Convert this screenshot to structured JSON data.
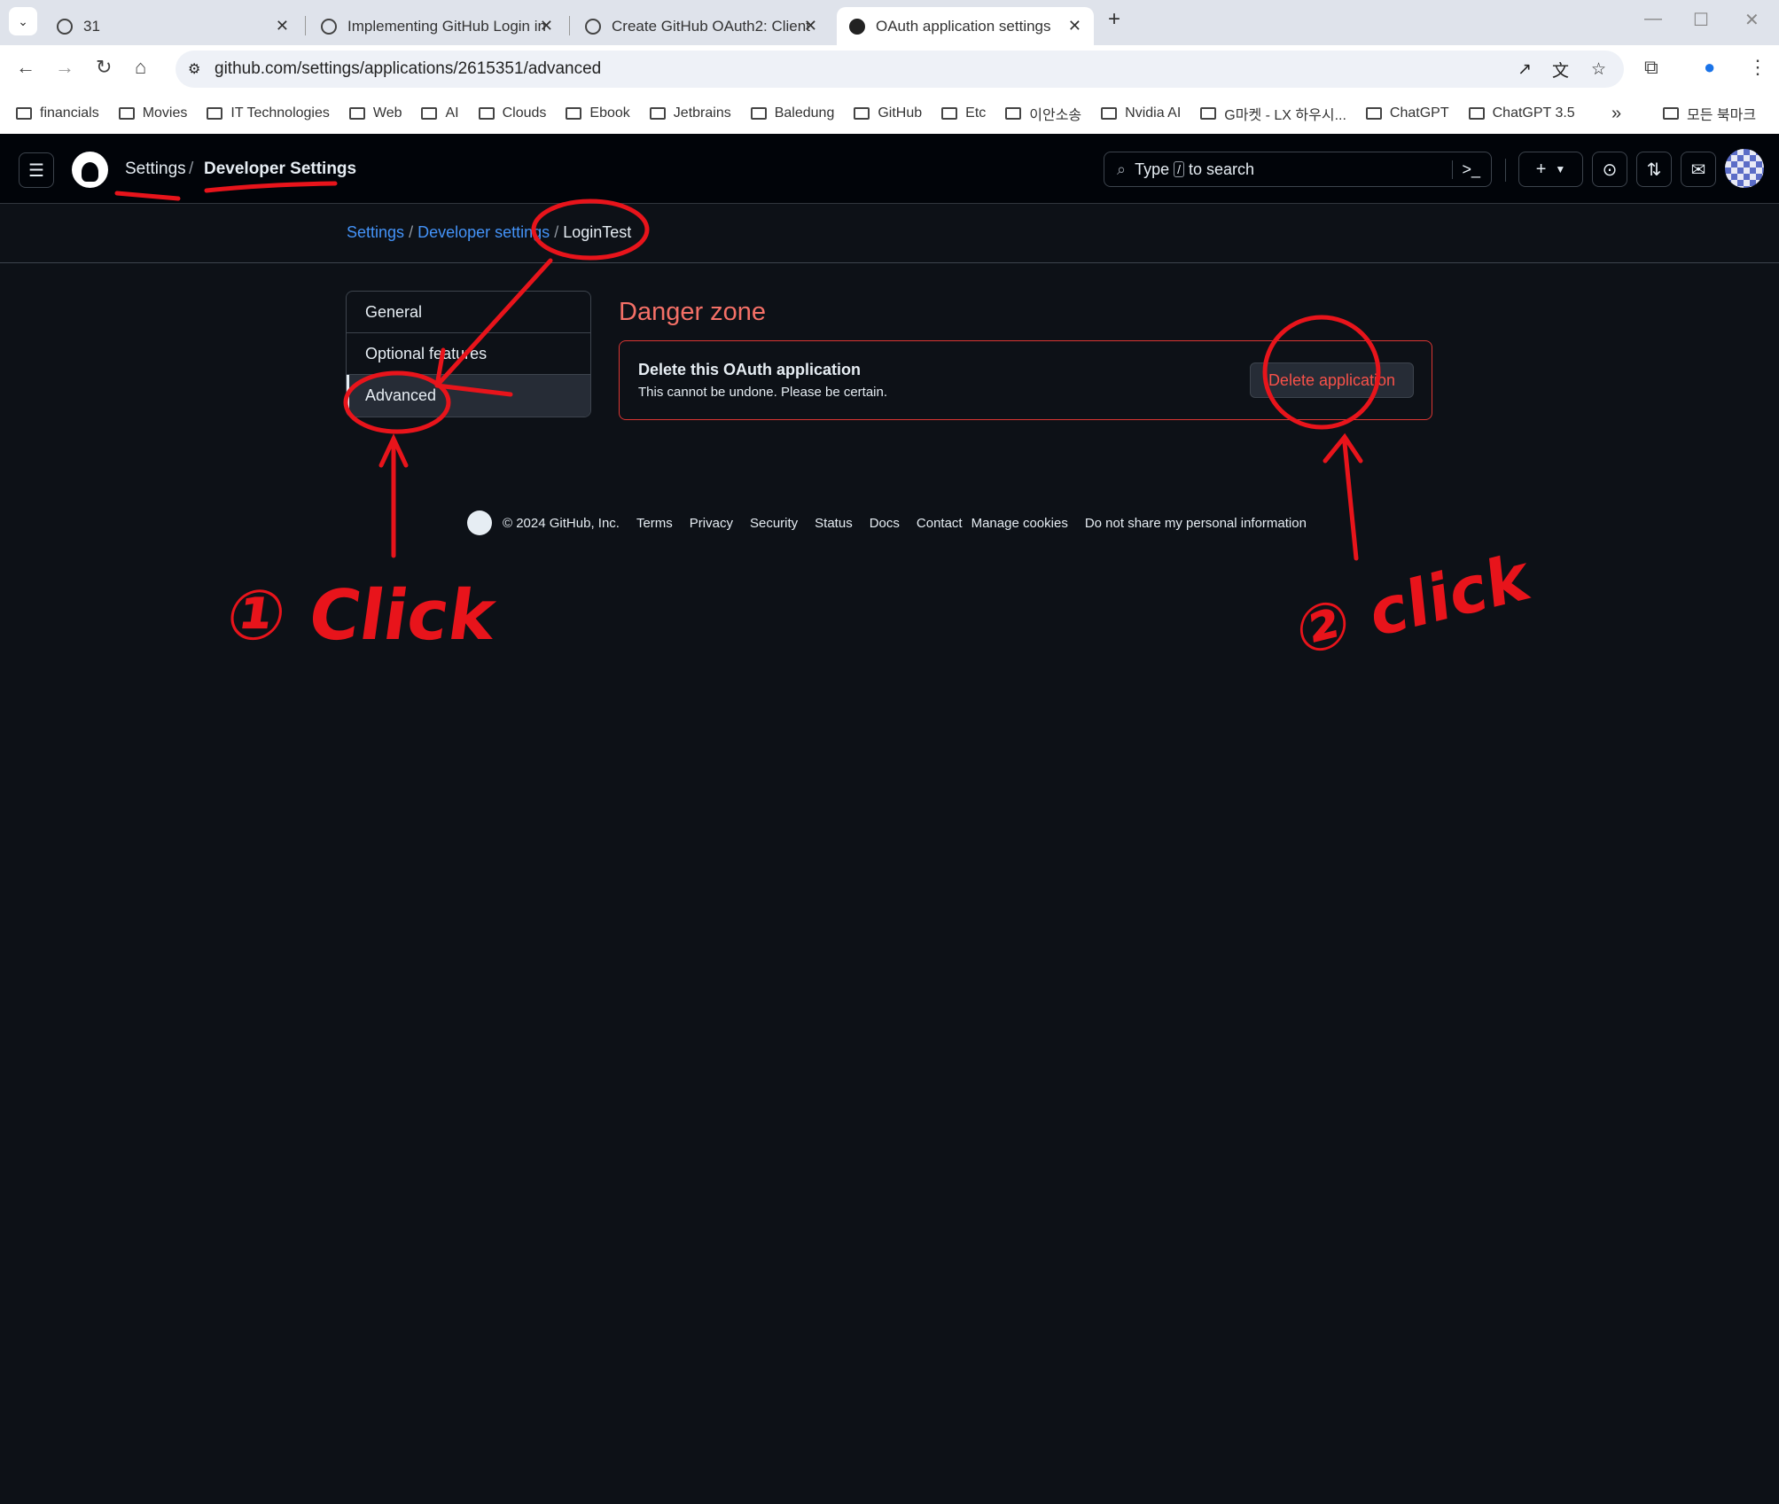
{
  "browser": {
    "tabs": [
      {
        "title": "31",
        "icon": "chatgpt-icon"
      },
      {
        "title": "Implementing GitHub Login in",
        "icon": "chatgpt-icon"
      },
      {
        "title": "Create GitHub OAuth2: Client",
        "icon": "chatgpt-icon"
      },
      {
        "title": "OAuth application settings",
        "icon": "github-icon",
        "active": true
      }
    ],
    "new_tab": "+",
    "url": "github.com/settings/applications/2615351/advanced",
    "bookmarks": [
      "financials",
      "Movies",
      "IT Technologies",
      "Web",
      "AI",
      "Clouds",
      "Ebook",
      "Jetbrains",
      "Baledung",
      "GitHub",
      "Etc",
      "이안소송",
      "Nvidia AI",
      "G마켓 - LX 하우시...",
      "ChatGPT",
      "ChatGPT 3.5"
    ],
    "more_bookmarks": "»",
    "all_bookmarks": "모든 북마크"
  },
  "header": {
    "context": "Settings",
    "separator": "/",
    "title": "Developer Settings",
    "search_prefix": "Type",
    "search_key": "/",
    "search_suffix": "to search"
  },
  "breadcrumb": {
    "items": [
      "Settings",
      "Developer settings",
      "LoginTest"
    ],
    "sep": "/"
  },
  "sidebar": {
    "items": [
      {
        "label": "General"
      },
      {
        "label": "Optional features"
      },
      {
        "label": "Advanced",
        "selected": true
      }
    ]
  },
  "danger": {
    "title": "Danger zone",
    "item_title": "Delete this OAuth application",
    "item_desc": "This cannot be undone. Please be certain.",
    "button": "Delete application"
  },
  "footer": {
    "copyright": "© 2024 GitHub, Inc.",
    "links": [
      "Terms",
      "Privacy",
      "Security",
      "Status",
      "Docs",
      "Contact",
      "Manage cookies",
      "Do not share my personal information"
    ]
  },
  "annotations": {
    "step1": "① Click",
    "step2": "② click",
    "color": "#e8141b"
  }
}
